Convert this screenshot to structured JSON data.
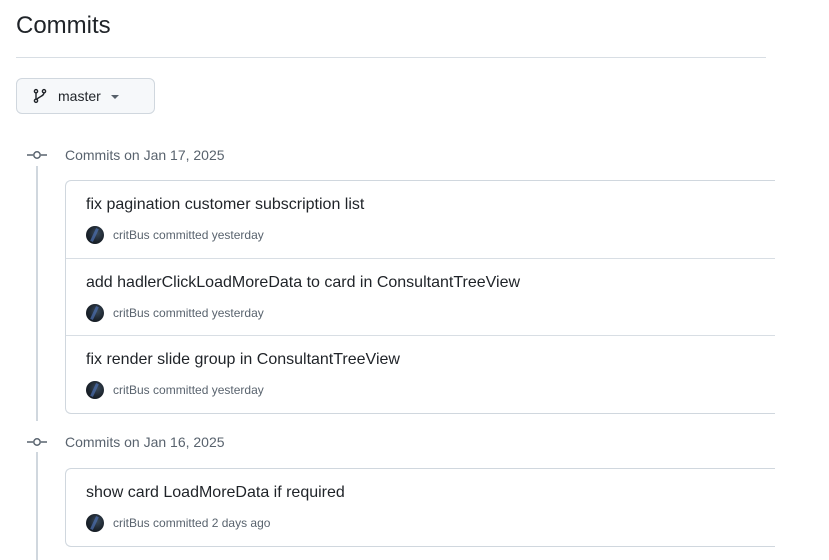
{
  "page": {
    "title": "Commits"
  },
  "branch": {
    "name": "master",
    "icon": "git-branch-icon"
  },
  "groups": [
    {
      "label": "Commits on Jan 17, 2025",
      "commits": [
        {
          "message": "fix pagination customer subscription list",
          "author": "critBus",
          "action": "committed",
          "time": "yesterday"
        },
        {
          "message": "add hadlerClickLoadMoreData to card in ConsultantTreeView",
          "author": "critBus",
          "action": "committed",
          "time": "yesterday"
        },
        {
          "message": "fix render slide group in ConsultantTreeView",
          "author": "critBus",
          "action": "committed",
          "time": "yesterday"
        }
      ]
    },
    {
      "label": "Commits on Jan 16, 2025",
      "commits": [
        {
          "message": "show card LoadMoreData if required",
          "author": "critBus",
          "action": "committed",
          "time": "2 days ago"
        }
      ]
    }
  ],
  "colors": {
    "text": "#1f2328",
    "muted": "#59636e",
    "border": "#d0d7de"
  }
}
